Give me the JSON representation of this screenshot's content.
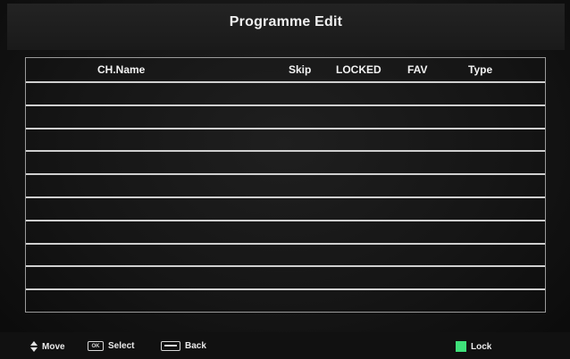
{
  "title": "Programme Edit",
  "table": {
    "columns": {
      "name": "CH.Name",
      "skip": "Skip",
      "locked": "LOCKED",
      "fav": "FAV",
      "type": "Type"
    },
    "row_count": 10
  },
  "footer": {
    "move_label": "Move",
    "select_key": "OK",
    "select_label": "Select",
    "back_label": "Back",
    "lock_label": "Lock",
    "lock_color": "#3fe07a"
  },
  "icons": {
    "move": "up-down-arrows-icon",
    "select": "ok-key-icon",
    "back": "menu-key-icon",
    "lock": "green-button-icon"
  }
}
